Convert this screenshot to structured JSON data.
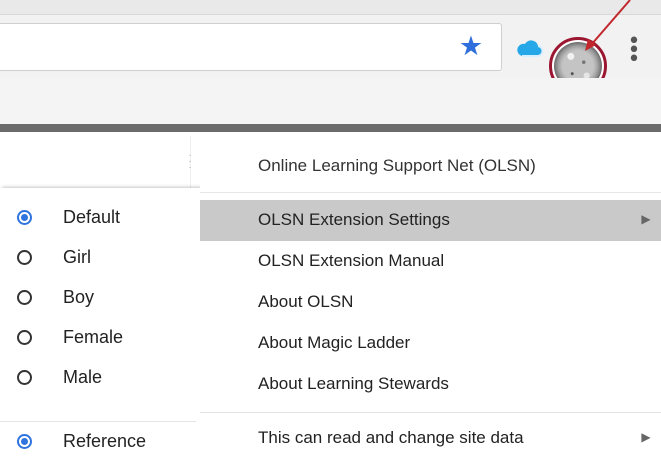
{
  "browser": {
    "icons": {
      "bookmark": "star-icon",
      "extension_cloud": "cloud-icon",
      "profile": "profile-avatar",
      "menu": "more-vertical-icon"
    },
    "highlight_color": "#9b1630",
    "arrow_color": "#c1272d"
  },
  "left_menu": {
    "options": [
      {
        "label": "Default",
        "checked": true
      },
      {
        "label": "Girl",
        "checked": false
      },
      {
        "label": "Boy",
        "checked": false
      },
      {
        "label": "Female",
        "checked": false
      },
      {
        "label": "Male",
        "checked": false
      }
    ],
    "reference": {
      "label": "Reference",
      "checked": true
    }
  },
  "extension_menu": {
    "title": "Online Learning Support Net (OLSN)",
    "items": [
      {
        "label": "OLSN Extension Settings",
        "has_submenu": true,
        "highlighted": true
      },
      {
        "label": "OLSN Extension Manual",
        "has_submenu": false,
        "highlighted": false
      },
      {
        "label": "About OLSN",
        "has_submenu": false,
        "highlighted": false
      },
      {
        "label": "About Magic Ladder",
        "has_submenu": false,
        "highlighted": false
      },
      {
        "label": "About Learning Stewards",
        "has_submenu": false,
        "highlighted": false
      }
    ],
    "footer_item": {
      "label": "This can read and change site data",
      "has_submenu": true
    }
  }
}
